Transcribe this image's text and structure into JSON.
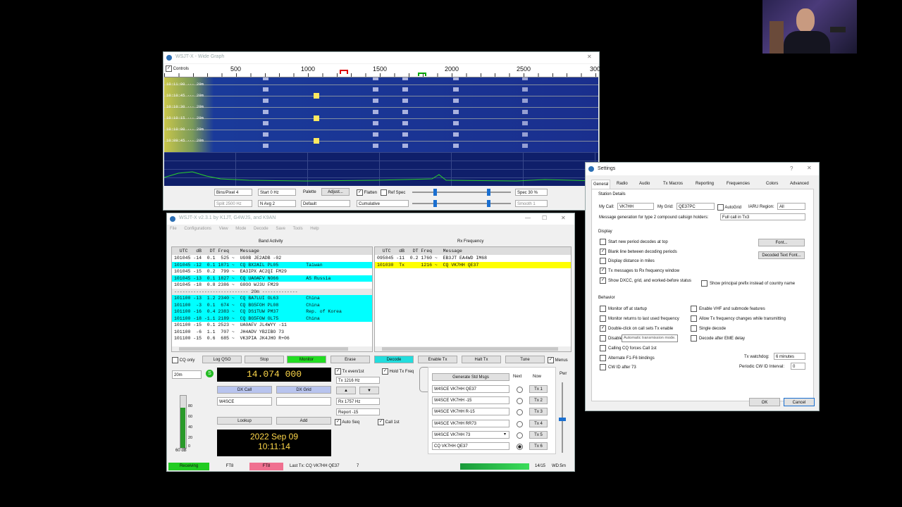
{
  "wide_graph": {
    "title": "WSJT-X - Wide Graph",
    "controls_label": "Controls",
    "freq_ticks": [
      "500",
      "1000",
      "1500",
      "2000",
      "2500",
      "300"
    ],
    "time_labels": [
      "10:11:00 ··· 20m",
      "10:10:45 ··· 20m",
      "10:10:30 ··· 20m",
      "10:10:15 ··· 20m",
      "10:10:00 ··· 20m",
      "10:09:45 ··· 20m"
    ],
    "bins_pixel": "Bins/Pixel  4",
    "start": "Start 0 Hz",
    "palette_label": "Palette",
    "adjust_label": "Adjust...",
    "flatten_label": "Flatten",
    "ref_spec_label": "Ref Spec",
    "spec_pct": "Spec 30 %",
    "split": "Split  2500 Hz",
    "n_avg": "N Avg  2",
    "palette_value": "Default",
    "mode_value": "Cumulative",
    "smooth": "Smooth  1"
  },
  "main": {
    "title": "WSJT-X   v2.3.1   by K1JT, G4WJS, and K9AN",
    "menu": [
      "File",
      "Configurations",
      "View",
      "Mode",
      "Decode",
      "Save",
      "Tools",
      "Help"
    ],
    "band_activity_title": "Band Activity",
    "rx_frequency_title": "Rx Frequency",
    "col_headers": "  UTC   dB   DT Freq    Message",
    "band_rows": [
      {
        "text": "101045 -14  0.1  525 ~  UG0B JE2ADB -02",
        "hl": ""
      },
      {
        "text": "101045 -12  0.1 1871 ~  CQ BX2AIL PL05          Taiwan",
        "hl": "cyan"
      },
      {
        "text": "101045 -15  0.2  799 ~  EA3IPX AC2QI FM29",
        "hl": ""
      },
      {
        "text": "101045 -13  0.1 1827 ~  CQ UA0AFV NO66          AS Russia",
        "hl": "cyan"
      },
      {
        "text": "101045 -18  0.8 2386 ~  G8OO WJ3U FM29",
        "hl": ""
      },
      {
        "text": "--------------------------- 20m -------------",
        "hl": "sep"
      },
      {
        "text": "101100 -13  1.2 2340 ~  CQ BA7LUI OL63          China",
        "hl": "cyan"
      },
      {
        "text": "101100  -3  0.1  674 ~  CQ BG5FOH PL08          China",
        "hl": "cyan"
      },
      {
        "text": "101100 -16  0.4 2383 ~  CQ DS1TUW PM37          Rep. of Korea",
        "hl": "cyan"
      },
      {
        "text": "101100 -18 -1.1 2189 ~  CQ BG5FOW OL75          China",
        "hl": "cyan"
      },
      {
        "text": "101100 -15  0.1 2523 ~  UA0AFV JL4WYY -11",
        "hl": ""
      },
      {
        "text": "101100  -6  1.1  707 ~  JH4ADV YB2IBO 73",
        "hl": ""
      },
      {
        "text": "101100 -15  0.6  685 ~  VK3PIA JK4JHO R+06",
        "hl": ""
      }
    ],
    "rx_rows": [
      {
        "text": "095845 -11  0.2 1760 ~  EB3JT EA4WD IM68",
        "hl": ""
      },
      {
        "text": "101030  Tx      1216 ~  CQ VK7HH QE37",
        "hl": "yellow"
      }
    ],
    "cq_only": "CQ only",
    "log_qso": "Log QSO",
    "stop": "Stop",
    "monitor": "Monitor",
    "erase": "Erase",
    "decode": "Decode",
    "enable_tx": "Enable Tx",
    "halt_tx": "Halt Tx",
    "tune": "Tune",
    "menus": "Menus",
    "band": "20m",
    "frequency": "14.074 000",
    "dx_call_label": "DX Call",
    "dx_grid_label": "DX Grid",
    "dx_call_value": "W4SCE",
    "dx_grid_value": "",
    "lookup": "Lookup",
    "add": "Add",
    "date": "2022 Sep 09",
    "time": "10:11:14",
    "tx_even": "Tx even/1st",
    "hold_tx_freq": "Hold Tx Freq",
    "tx_freq": "Tx  1216 Hz",
    "rx_freq": "Rx  1757 Hz",
    "report": "Report -15",
    "auto_seq": "Auto Seq",
    "call_1st": "Call 1st",
    "gen_std_msgs": "Generate Std Msgs",
    "next_label": "Next",
    "now_label": "Now",
    "tx_msgs": [
      "W4SCE VK7HH QE37",
      "W4SCE VK7HH -15",
      "W4SCE VK7HH R-15",
      "W4SCE VK7HH RR73",
      "W4SCE VK7HH 73",
      "CQ VK7HH QE37"
    ],
    "tx_buttons": [
      "Tx 1",
      "Tx 2",
      "Tx 3",
      "Tx 4",
      "Tx 5",
      "Tx 6"
    ],
    "pwr_label": "Pwr",
    "meter_ticks": [
      "80",
      "60",
      "40",
      "20",
      "0"
    ],
    "meter_db": "60 dB",
    "status_receiving": "Receiving",
    "status_mode": "FT8",
    "status_mode2": "FT8",
    "status_last_tx": "Last Tx: CQ VK7HH QE37",
    "status_num": "7",
    "status_count": "14/15",
    "status_wd": "WD:5m"
  },
  "settings": {
    "title": "Settings",
    "help": "?",
    "tabs": [
      "General",
      "Radio",
      "Audio",
      "Tx Macros",
      "Reporting",
      "Frequencies",
      "Colors",
      "Advanced"
    ],
    "station_details": "Station Details",
    "my_call_label": "My Call:",
    "my_call": "VK7HH",
    "my_grid_label": "My Grid:",
    "my_grid": "QE37PC",
    "autogrid": "AutoGrid",
    "iaru_label": "IARU Region:",
    "iaru": "All",
    "msg_gen_label": "Message generation for type 2 compound callsign holders:",
    "msg_gen": "Full call in Tx3",
    "display": "Display",
    "display_opts": [
      {
        "label": "Start new period decodes at top",
        "checked": false
      },
      {
        "label": "Blank line between decoding periods",
        "checked": true
      },
      {
        "label": "Display distance in miles",
        "checked": false
      },
      {
        "label": "Tx messages to Rx frequency window",
        "checked": true
      },
      {
        "label": "Show DXCC, grid, and worked-before status",
        "checked": true
      }
    ],
    "principal_prefix": "Show principal prefix instead of country name",
    "font_btn": "Font...",
    "decoded_font_btn": "Decoded Text Font...",
    "behavior": "Behavior",
    "behavior_left": [
      {
        "label": "Monitor off at startup",
        "checked": false
      },
      {
        "label": "Monitor returns to last used frequency",
        "checked": false
      },
      {
        "label": "Double-click on call sets Tx enable",
        "checked": true
      },
      {
        "label": "Disable",
        "checked": false
      },
      {
        "label": "Calling CQ forces Call 1st",
        "checked": false
      },
      {
        "label": "Alternate F1-F6 bindings",
        "checked": false
      },
      {
        "label": "CW ID after 73",
        "checked": false
      }
    ],
    "tooltip": "Automatic transmission mode.",
    "behavior_right": [
      {
        "label": "Enable VHF and submode features",
        "checked": false
      },
      {
        "label": "Allow Tx frequency changes while transmitting",
        "checked": false
      },
      {
        "label": "Single decode",
        "checked": false
      },
      {
        "label": "Decode after EME delay",
        "checked": false
      }
    ],
    "tx_watchdog_label": "Tx watchdog:",
    "tx_watchdog": "6 minutes",
    "cw_interval_label": "Periodic CW ID Interval:",
    "cw_interval": "0",
    "ok": "OK",
    "cancel": "Cancel"
  }
}
